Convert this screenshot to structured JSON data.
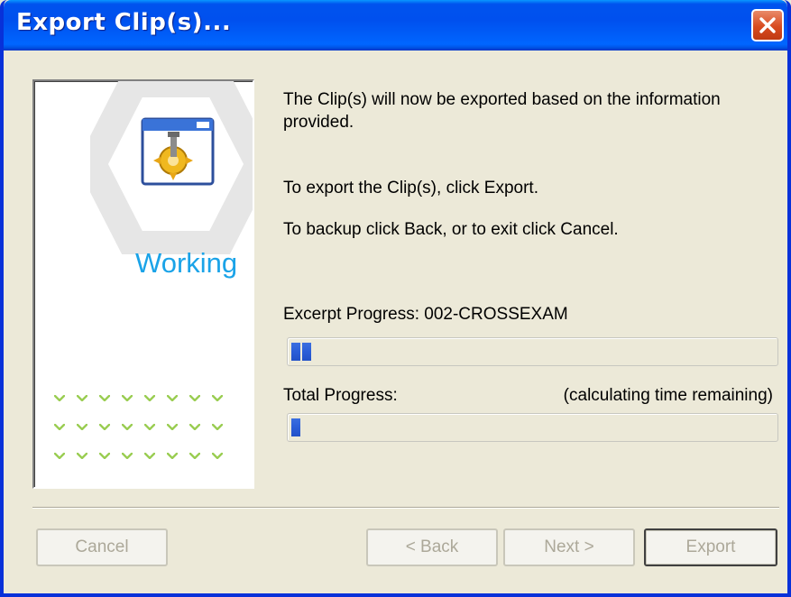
{
  "window": {
    "title": "Export Clip(s)..."
  },
  "titlebar": {
    "close_icon": "close-icon",
    "close_color": "#d84b20"
  },
  "left_panel": {
    "status_label": "Working",
    "status_color": "#1aa3e8",
    "icon": "application-gear-icon",
    "dot_color": "#9acd52"
  },
  "main": {
    "message_line1": "The Clip(s) will now be exported based on the information provided.",
    "message_line2": "To export the Clip(s), click Export.",
    "message_line3": "To backup click Back, or to exit click Cancel."
  },
  "excerpt_progress": {
    "label": "Excerpt Progress: 002-CROSSEXAM",
    "value_percent": 4
  },
  "total_progress": {
    "label": "Total Progress:",
    "time_remaining": "(calculating time remaining)",
    "value_percent": 2
  },
  "buttons": {
    "cancel": "Cancel",
    "back": "< Back",
    "next": "Next >",
    "export": "Export"
  },
  "colors": {
    "titlebar": "#0050ee",
    "progress_fill": "#2b5ed8",
    "disabled_text": "#aca899"
  }
}
